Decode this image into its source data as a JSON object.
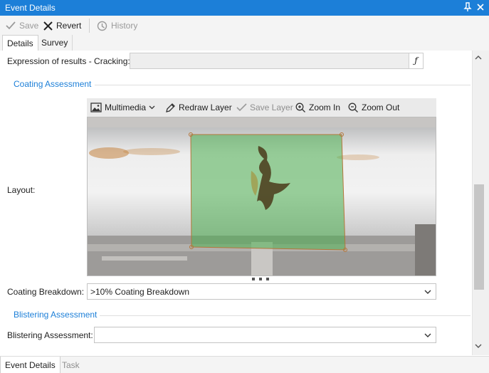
{
  "window": {
    "title": "Event Details"
  },
  "toolbar": {
    "save_label": "Save",
    "revert_label": "Revert",
    "history_label": "History"
  },
  "tabs": [
    {
      "label": "Details"
    },
    {
      "label": "Survey"
    }
  ],
  "form": {
    "expression_label": "Expression of results - Cracking:",
    "expression_value": "",
    "expression_button": "ƒ",
    "coating_section": "Coating Assessment",
    "layout_label": "Layout:",
    "media_toolbar": {
      "multimedia_label": "Multimedia",
      "redraw_label": "Redraw Layer",
      "save_layer_label": "Save Layer",
      "zoom_in_label": "Zoom In",
      "zoom_out_label": "Zoom Out"
    },
    "coating_breakdown_label": "Coating Breakdown:",
    "coating_breakdown_value": ">10% Coating Breakdown",
    "blistering_section": "Blistering Assessment",
    "blistering_label": "Blistering Assessment:",
    "blistering_value": ""
  },
  "bottom_tabs": [
    {
      "label": "Event Details"
    },
    {
      "label": "Task"
    }
  ],
  "colors": {
    "accent": "#1c7fd8",
    "overlay": "#4caf50",
    "overlay_border": "#b5763a"
  }
}
